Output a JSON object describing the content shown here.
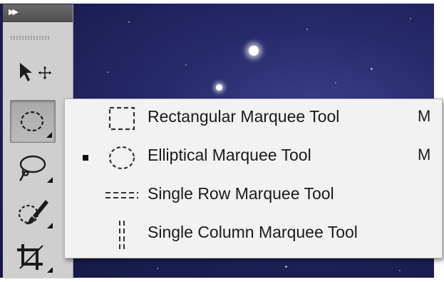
{
  "tools_panel": {
    "collapse_glyph": "▶▶",
    "tools": [
      {
        "name": "move-tool",
        "icon": "move-arrow-icon"
      },
      {
        "name": "marquee-tool",
        "icon": "elliptical-marquee-icon",
        "active": true
      },
      {
        "name": "lasso-tool",
        "icon": "lasso-icon"
      },
      {
        "name": "quick-selection-tool",
        "icon": "quick-selection-brush-icon"
      },
      {
        "name": "crop-tool",
        "icon": "crop-icon"
      }
    ]
  },
  "flyout_menu": {
    "items": [
      {
        "label": "Rectangular Marquee Tool",
        "shortcut": "M",
        "icon": "rectangular-marquee-icon",
        "selected": false
      },
      {
        "label": "Elliptical Marquee Tool",
        "shortcut": "M",
        "icon": "elliptical-marquee-icon",
        "selected": true
      },
      {
        "label": "Single Row Marquee Tool",
        "shortcut": "",
        "icon": "single-row-marquee-icon",
        "selected": false
      },
      {
        "label": "Single Column Marquee Tool",
        "shortcut": "",
        "icon": "single-column-marquee-icon",
        "selected": false
      }
    ]
  },
  "colors": {
    "canvas_background": "#1b1d52",
    "panel_background": "#cfcfcf",
    "menu_background": "#f2f2f2",
    "text": "#1a1a1a"
  }
}
